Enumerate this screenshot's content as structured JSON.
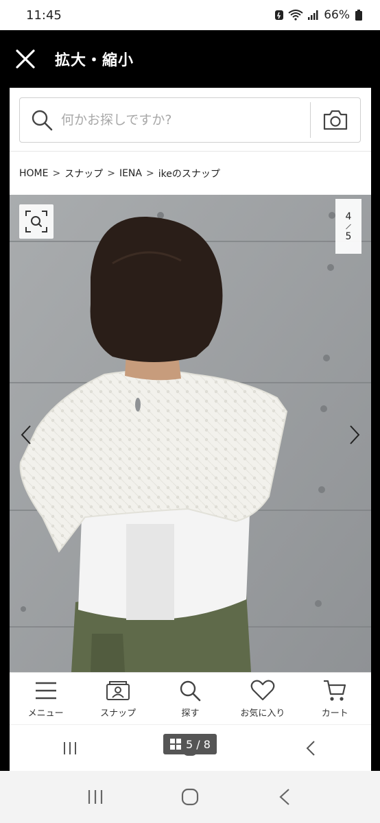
{
  "status": {
    "time": "11:45",
    "battery": "66%"
  },
  "app_bar": {
    "title": "拡大・縮小"
  },
  "search": {
    "placeholder": "何かお探しですか?"
  },
  "breadcrumb": {
    "items": [
      "HOME",
      "スナップ",
      "IENA",
      "ikeのスナップ"
    ],
    "separator": ">"
  },
  "photo": {
    "page_current": "4",
    "page_total": "5"
  },
  "bottom_nav": {
    "items": [
      {
        "label": "メニュー",
        "icon": "menu-icon"
      },
      {
        "label": "スナップ",
        "icon": "snap-icon"
      },
      {
        "label": "探す",
        "icon": "search-icon"
      },
      {
        "label": "お気に入り",
        "icon": "heart-icon"
      },
      {
        "label": "カート",
        "icon": "cart-icon"
      }
    ]
  },
  "image_counter": {
    "text": "5 / 8"
  },
  "colors": {
    "app_bar_bg": "#000000",
    "frame_bg": "#ffffff",
    "counter_bg": "#555555"
  }
}
